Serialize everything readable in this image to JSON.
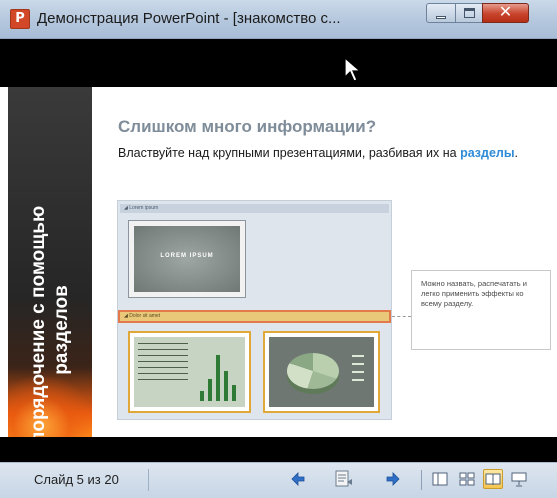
{
  "window": {
    "title": "Демонстрация PowerPoint - [знакомство с...",
    "app_icon_letter": "P",
    "close_glyph": "✕"
  },
  "slide": {
    "section_title": "Упорядочение с помощью разделов",
    "title": "Слишком много информации?",
    "subtitle_text": "Властвуйте над крупными презентациями, разбивая их на ",
    "subtitle_link": "разделы",
    "subtitle_end": ".",
    "screenshot": {
      "section_1": "◢ Lorem ipsum",
      "lorem_label": "LOREM IPSUM",
      "section_2": "◢ Dolor sit amet"
    },
    "callout": "Можно назвать, распечатать и легко применить эффекты ко всему разделу."
  },
  "statusbar": {
    "slide_counter": "Слайд 5 из 20",
    "icons": [
      "previous-icon",
      "menu-icon",
      "next-icon",
      "normal-view-icon",
      "slide-sorter-icon",
      "reading-view-icon",
      "slide-show-icon"
    ],
    "active_view": "reading-view"
  },
  "colors": {
    "accent_orange": "#e85a10",
    "link_blue": "#2e8bd8",
    "active_view_bg": "#f6c54f"
  }
}
